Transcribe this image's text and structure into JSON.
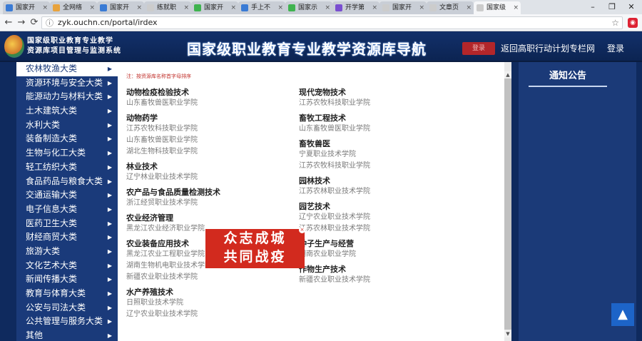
{
  "browser": {
    "tabs": [
      {
        "label": "国家开",
        "color": "#3a7bd5"
      },
      {
        "label": "全网络",
        "color": "#e8a33d"
      },
      {
        "label": "国家开",
        "color": "#3a7bd5"
      },
      {
        "label": "练就职",
        "color": "#cccccc"
      },
      {
        "label": "国家开",
        "color": "#3fb34f"
      },
      {
        "label": "手上不",
        "color": "#3a7bd5"
      },
      {
        "label": "国家示",
        "color": "#3fb34f"
      },
      {
        "label": "开学第",
        "color": "#7a4fd0"
      },
      {
        "label": "国家开",
        "color": "#cccccc"
      },
      {
        "label": "文章页",
        "color": "#cccccc"
      },
      {
        "label": "国家级",
        "color": "#cccccc"
      }
    ],
    "url": "zyk.ouchn.cn/portal/irdex",
    "minimize": "–",
    "maximize": "❐",
    "close": "✕"
  },
  "header": {
    "logo_text_line1": "国家级职业教育专业教学",
    "logo_text_line2": "资源库项目管理与监测系统",
    "title": "国家级职业教育专业教学资源库导航",
    "login_label": "登录",
    "back_link": "返回高职行动计划专栏网",
    "register_label": "登录"
  },
  "sidebar": {
    "items": [
      "农林牧渔大类",
      "资源环境与安全大类",
      "能源动力与材料大类",
      "土木建筑大类",
      "水利大类",
      "装备制造大类",
      "生物与化工大类",
      "轻工纺织大类",
      "食品药品与粮食大类",
      "交通运输大类",
      "电子信息大类",
      "医药卫生大类",
      "财经商贸大类",
      "旅游大类",
      "文化艺术大类",
      "新闻传播大类",
      "教育与体育大类",
      "公安与司法大类",
      "公共管理与服务大类",
      "其他"
    ]
  },
  "content": {
    "note": "注：按资源库名称首字母排序",
    "left": [
      {
        "major": "动物检疫检验技术",
        "schools": [
          "山东畜牧兽医职业学院"
        ]
      },
      {
        "major": "动物药学",
        "schools": [
          "江苏农牧科技职业学院",
          "山东畜牧兽医职业学院",
          "湖北生物科技职业学院"
        ]
      },
      {
        "major": "林业技术",
        "schools": [
          "辽宁林业职业技术学院"
        ]
      },
      {
        "major": "农产品与食品质量检测技术",
        "schools": [
          "浙江经贸职业技术学院"
        ]
      },
      {
        "major": "农业经济管理",
        "schools": [
          "黑龙江农业经济职业学院"
        ]
      },
      {
        "major": "农业装备应用技术",
        "schools": [
          "黑龙江农业工程职业学院",
          "湖南生物机电职业技术学院",
          "新疆农业职业技术学院"
        ]
      },
      {
        "major": "水产养殖技术",
        "schools": [
          "日照职业技术学院",
          "辽宁农业职业技术学院"
        ]
      }
    ],
    "right": [
      {
        "major": "现代宠物技术",
        "schools": [
          "江苏农牧科技职业学院"
        ]
      },
      {
        "major": "畜牧工程技术",
        "schools": [
          "山东畜牧兽医职业学院"
        ]
      },
      {
        "major": "畜牧兽医",
        "schools": [
          "宁夏职业技术学院",
          "江苏农牧科技职业学院"
        ]
      },
      {
        "major": "园林技术",
        "schools": [
          "江苏农林职业技术学院"
        ]
      },
      {
        "major": "园艺技术",
        "schools": [
          "辽宁农业职业技术学院",
          "江苏农林职业技术学院"
        ]
      },
      {
        "major": "种子生产与经营",
        "schools": [
          "湖南农业职业学院"
        ]
      },
      {
        "major": "作物生产技术",
        "schools": [
          "新疆农业职业技术学院"
        ]
      }
    ]
  },
  "notice": {
    "title": "通知公告"
  },
  "banner": {
    "line1": "众志成城",
    "line2": "共同战疫",
    "close": "×"
  },
  "icons": {
    "back": "←",
    "forward": "→",
    "reload": "⟳",
    "star": "☆",
    "to_top": "▲"
  }
}
